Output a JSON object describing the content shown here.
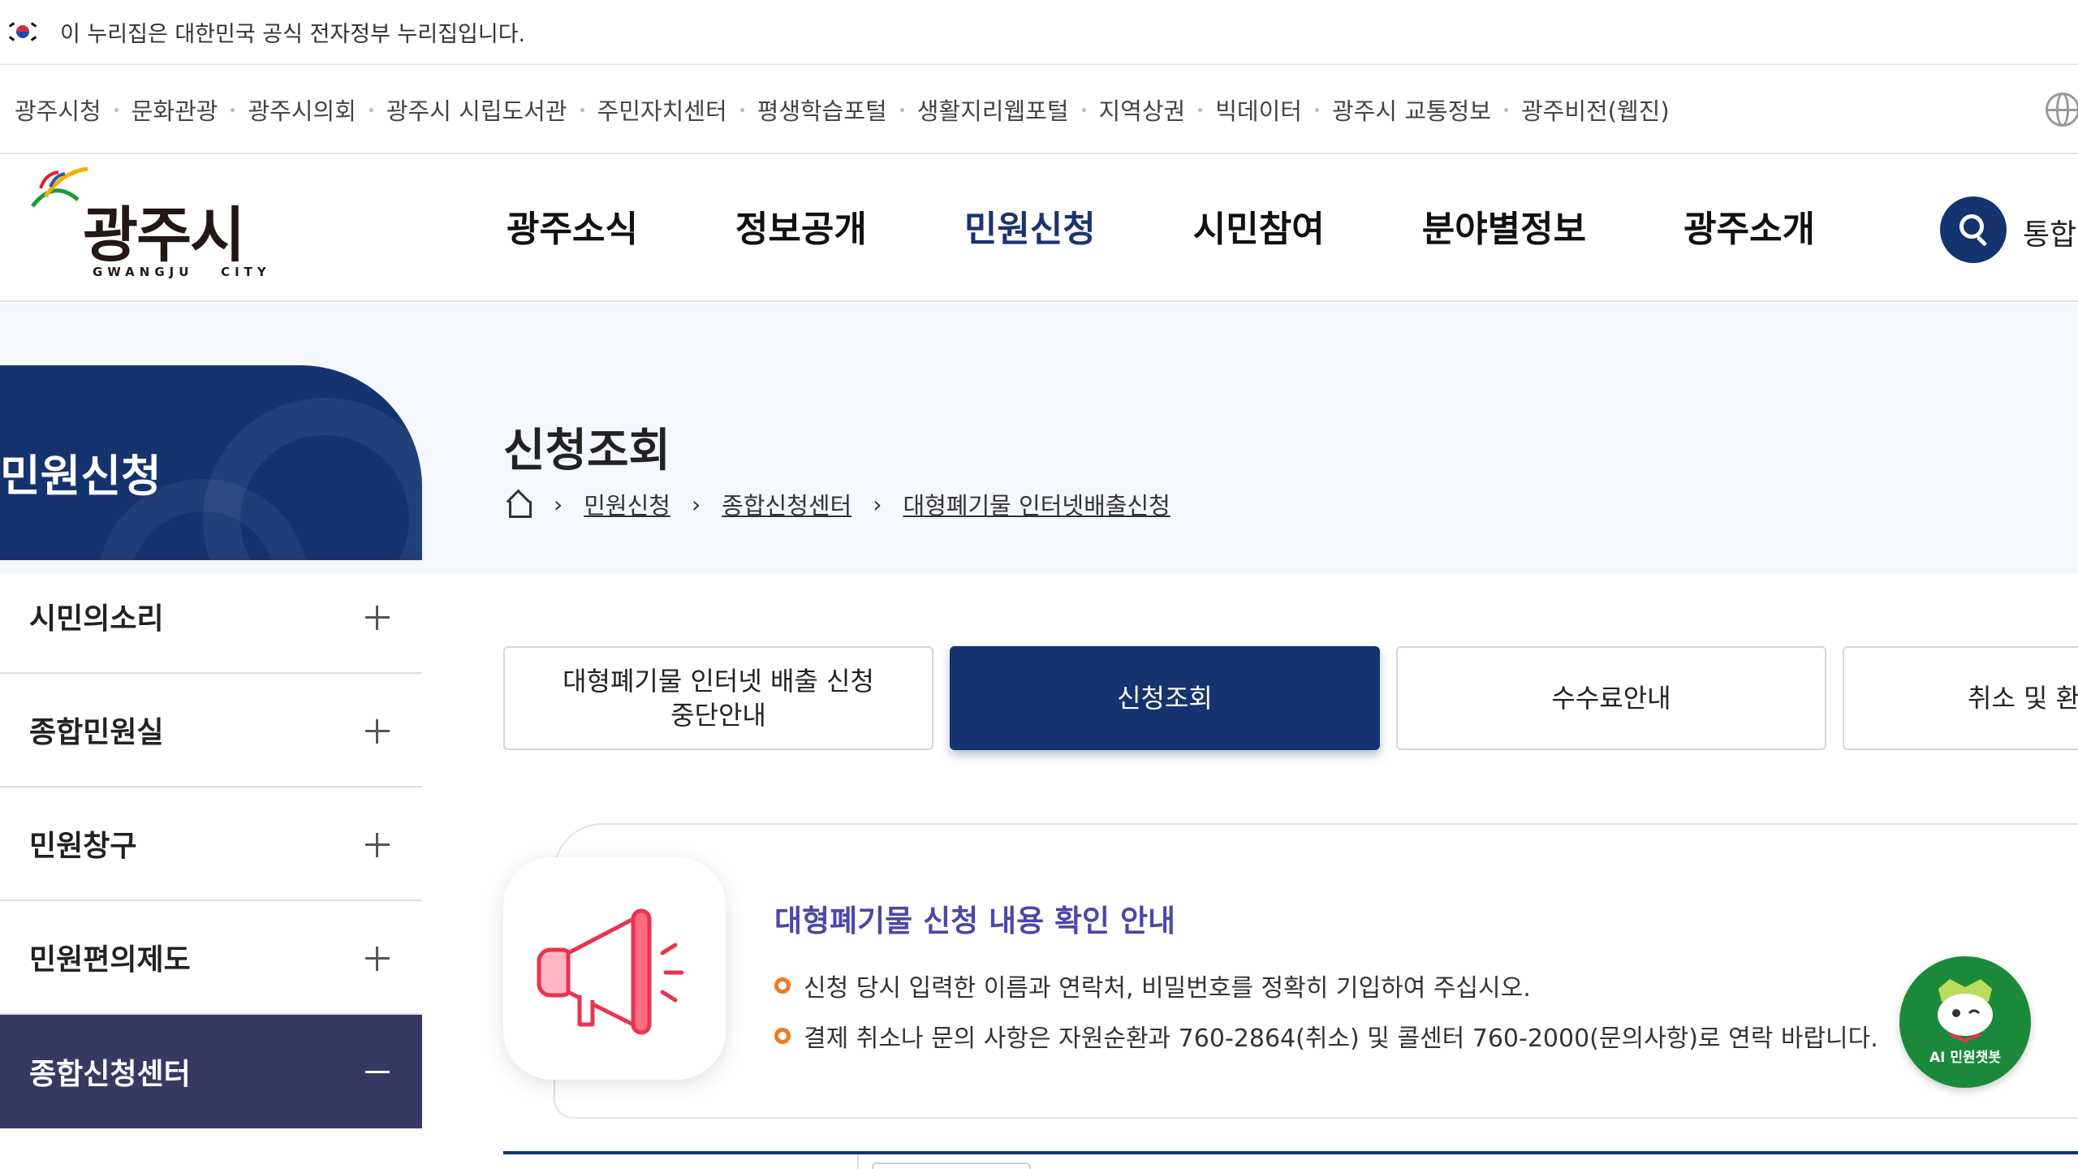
{
  "gov_banner": {
    "text": "이 누리집은 대한민국 공식 전자정부 누리집입니다."
  },
  "family_links": [
    "광주시청",
    "문화관광",
    "광주시의회",
    "광주시 시립도서관",
    "주민자치센터",
    "평생학습포털",
    "생활지리웹포털",
    "지역상권",
    "빅데이터",
    "광주시 교통정보",
    "광주비전(웹진)"
  ],
  "logo": {
    "main": "광주시",
    "sub": "GWANGJU   CITY"
  },
  "gnb": [
    "광주소식",
    "정보공개",
    "민원신청",
    "시민참여",
    "분야별정보",
    "광주소개"
  ],
  "gnb_active_index": 2,
  "search": {
    "label": "통합검색"
  },
  "page": {
    "title": "신청조회",
    "breadcrumb": [
      "민원신청",
      "종합신청센터",
      "대형폐기물 인터넷배출신청"
    ]
  },
  "sidebar": {
    "title": "민원신청",
    "items": [
      {
        "label": "시민의소리",
        "expanded": false
      },
      {
        "label": "종합민원실",
        "expanded": false
      },
      {
        "label": "민원창구",
        "expanded": false
      },
      {
        "label": "민원편의제도",
        "expanded": false
      },
      {
        "label": "종합신청센터",
        "expanded": true
      }
    ]
  },
  "tabs": [
    {
      "label": "대형폐기물 인터넷 배출 신청\n중단안내",
      "active": false
    },
    {
      "label": "신청조회",
      "active": true
    },
    {
      "label": "수수료안내",
      "active": false
    },
    {
      "label": "취소 및 환불안내",
      "active": false
    }
  ],
  "notice": {
    "icon": "megaphone-icon",
    "title": "대형폐기물 신청 내용 확인 안내",
    "lines": [
      "신청 당시 입력한 이름과 연락처, 비밀번호를 정확히 기입하여 주십시오.",
      "결제 취소나 문의 사항은 자원순환과 760-2864(취소) 및 콜센터 760-2000(문의사항)로 연락 바랍니다."
    ]
  },
  "chatbot": {
    "label": "AI 민원챗봇"
  },
  "colors": {
    "navy": "#15336f",
    "active_side": "#383962",
    "notice_title": "#4b48a8",
    "bullet": "#f07a24",
    "chatbot": "#1a8a3a"
  }
}
